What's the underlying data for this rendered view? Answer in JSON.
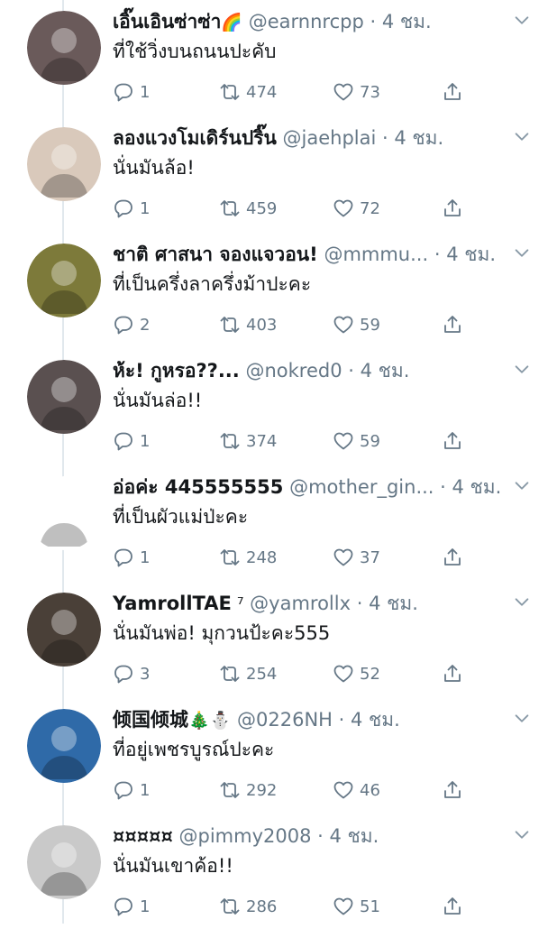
{
  "tweets": [
    {
      "name": "เอิ๊นเอินซ่าซ่า",
      "name_suffix": "🌈",
      "handle": "@earnnrcpp",
      "sep": " · ",
      "time": "4 ชม.",
      "text": "ที่ใช้วิ่งบนถนนปะคับ",
      "replies": "1",
      "retweets": "474",
      "likes": "73",
      "avatar_color": "#6a5a5a"
    },
    {
      "name": "ลองแวงโมเดิร์นปริ๊น",
      "name_suffix": "",
      "handle": "@jaehplai",
      "sep": " · ",
      "time": "4 ชม.",
      "text": "นั่นมันล้อ!",
      "replies": "1",
      "retweets": "459",
      "likes": "72",
      "avatar_color": "#d9c9bb"
    },
    {
      "name": "ชาติ ศาสนา จองแจวอน!",
      "name_suffix": "",
      "handle": "@mmmu...",
      "sep": " · ",
      "time": "4 ชม.",
      "text": "ที่เป็นครึ่งลาครึ่งม้าปะคะ",
      "replies": "2",
      "retweets": "403",
      "likes": "59",
      "avatar_color": "#7d7a3a"
    },
    {
      "name": "ห้ะ! กูหรอ??...",
      "name_suffix": "",
      "handle": "@nokred0",
      "sep": " · ",
      "time": "4 ชม.",
      "text": "นั่นมันล่อ!!",
      "replies": "1",
      "retweets": "374",
      "likes": "59",
      "avatar_color": "#5a5050"
    },
    {
      "name": "อ่อค่ะ 445555555",
      "name_suffix": "",
      "handle": "@mother_gin...",
      "sep": " · ",
      "time": "4 ชม.",
      "text": "ที่เป็นผัวแม่ป่ะคะ",
      "replies": "1",
      "retweets": "248",
      "likes": "37",
      "avatar_color": "#ffffff"
    },
    {
      "name": "YamrollTAE",
      "name_suffix": " ⁷",
      "handle": "@yamrollx",
      "sep": " · ",
      "time": "4 ชม.",
      "text": "นั่นมันพ่อ! มุกวนป้ะคะ555",
      "replies": "3",
      "retweets": "254",
      "likes": "52",
      "avatar_color": "#4a4038"
    },
    {
      "name": "倾国倾城",
      "name_suffix": "🎄⛄",
      "handle": "@0226NH",
      "sep": " · ",
      "time": "4 ชม.",
      "text": "ที่อยู่เพชรบูรณ์ปะคะ",
      "replies": "1",
      "retweets": "292",
      "likes": "46",
      "avatar_color": "#2f6aa8"
    },
    {
      "name": "¤¤¤¤¤",
      "name_suffix": "",
      "handle": "@pimmy2008",
      "sep": " · ",
      "time": "4 ชม.",
      "text": "นั่นมันเขาค้อ!!",
      "replies": "1",
      "retweets": "286",
      "likes": "51",
      "avatar_color": "#c9c9c9"
    }
  ],
  "icons": {
    "reply": "reply-icon",
    "retweet": "retweet-icon",
    "like": "like-icon",
    "share": "share-icon",
    "more": "chevron-down-icon"
  },
  "colors": {
    "text": "#14171a",
    "muted": "#657786",
    "thread": "#e1e8ed"
  }
}
